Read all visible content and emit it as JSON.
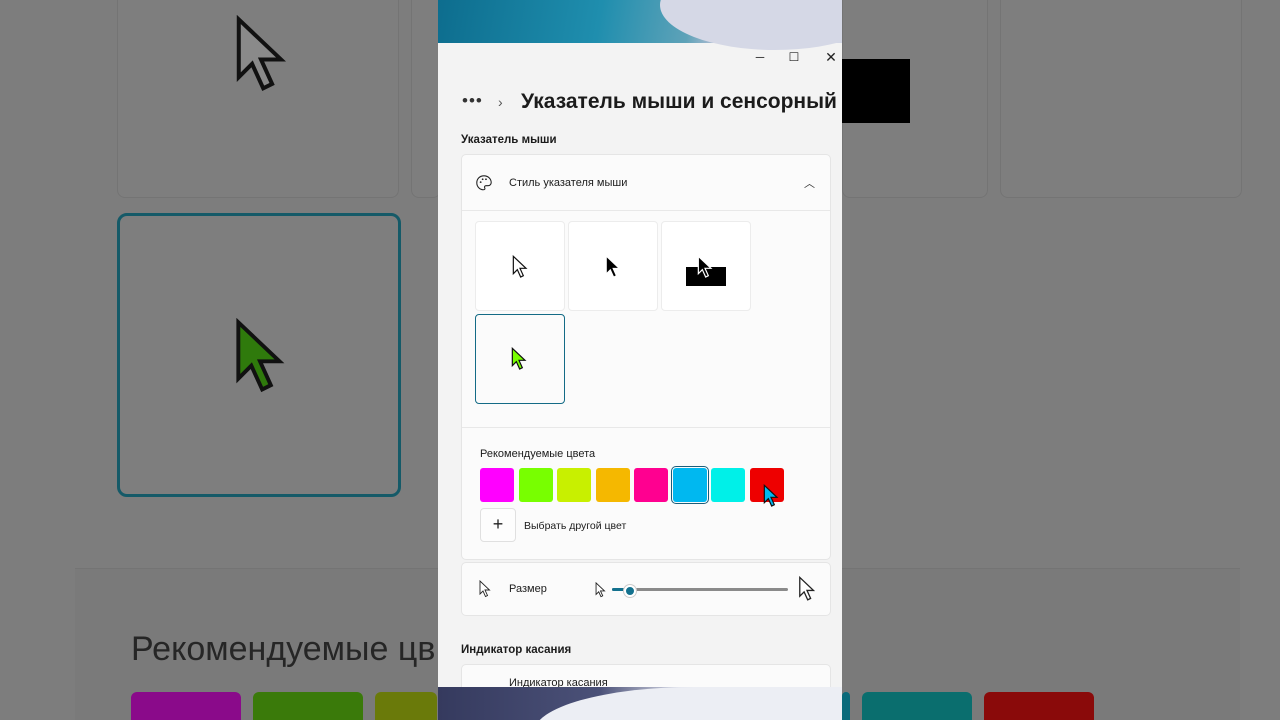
{
  "window": {
    "page_title": "Указатель мыши и сенсорный",
    "more_icon": "ellipsis-icon",
    "caption_buttons": {
      "minimize": "─",
      "maximize": "☐",
      "close": "✕"
    }
  },
  "mouse_pointer_section": {
    "heading": "Указатель мыши",
    "style_row_label": "Стиль указателя мыши",
    "style_row_icon": "palette-icon",
    "styles": [
      {
        "name": "white",
        "selected": false
      },
      {
        "name": "black",
        "selected": false
      },
      {
        "name": "inverted",
        "selected": false
      },
      {
        "name": "custom",
        "selected": true
      }
    ],
    "recommended_colors_label": "Рекомендуемые цвета",
    "recommended_colors": [
      "#ff00ff",
      "#78ff00",
      "#c8f000",
      "#f5b800",
      "#ff0090",
      "#00b8f0",
      "#00f0e8",
      "#ee0000"
    ],
    "selected_color_index": 5,
    "pick_color_label": "Выбрать другой цвет",
    "size_label": "Размер",
    "size_value_fraction": 0.1
  },
  "touch_section": {
    "heading": "Индикатор касания",
    "row_label": "Индикатор касания"
  },
  "background": {
    "big_label": "Рекомендуемые цв",
    "colors": [
      "#8a0a8a",
      "#3a7a0a",
      "#6a7a0a",
      "#0a6a7a",
      "#0a6e6e",
      "#8a0a0a"
    ]
  }
}
